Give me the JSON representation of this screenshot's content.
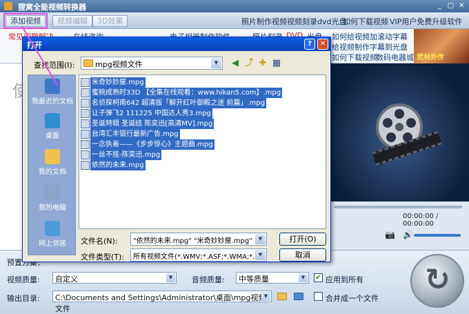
{
  "app": {
    "title": "狸窝全能视频转换器"
  },
  "toolbar": {
    "add_video": "添加视频",
    "video_edit": "视频编辑",
    "effect_3d": "3D效果",
    "links": [
      "照片制作视频",
      "视频刻录dvd光盘",
      "如何下载视频",
      "VIP用户免费升级软件"
    ]
  },
  "banner": {
    "items": [
      "常见问题解决",
      "在线咨询",
      "电子相册制作软件",
      "照片刻录",
      "DVD",
      "光盘",
      "如何给视频加滚动字幕",
      "给视频制作字幕到光盘",
      "如何下载视频",
      "数码电器城"
    ],
    "ad_caption": "武林外传"
  },
  "left_panel": {
    "placeholder_glyph": "使"
  },
  "preview": {
    "time": "00:00:00 / 00:00:00"
  },
  "dialog": {
    "title": "打开",
    "look_in_label": "查找范围(I):",
    "look_in_value": "mpg视频文件",
    "places": [
      "我最近的文档",
      "桌面",
      "我的文档",
      "我的电脑",
      "网上邻居"
    ],
    "files": [
      "米奇妙妙屋.mpg",
      "蜜桃成熟时33D 【全集在线观看：www.hikan5.com】.mpg",
      "名侦探柯南642 超清版「解开红叶御殿之迷 前篇」.mpg",
      "让子弹飞2 111225 中国达人秀3.mpg",
      "圣诞特辑 圣诞结 陈奕迅[高清MV].mpg",
      "台湾汇丰银行最新广告.mpg",
      "一念执着——《步步惊心》主题曲.mpg",
      "一丝不挂-陈奕迅.mpg",
      "依然的未来.mpg"
    ],
    "file_name_label": "文件名(N):",
    "file_name_value": "\"依然的未来.mpg\" \"米奇妙妙屋.mpg\" \"蜜",
    "file_type_label": "文件类型(T):",
    "file_type_value": "所有视频文件(*.WMV;*.ASF;*.WMA;*.AVI;",
    "open_button": "打开(O)",
    "cancel_button": "取消"
  },
  "settings": {
    "preset_label": "预置方案：",
    "video_quality_label": "视频质量:",
    "video_quality_value": "自定义",
    "audio_quality_label": "音频质量:",
    "audio_quality_value": "中等质量",
    "apply_all_label": "应用到所有",
    "output_label": "输出目录:",
    "output_value": "C:\\Documents and Settings\\Administrator\\桌面\\mpg视频文件",
    "merge_label": "合并成一个文件"
  },
  "colors": {
    "highlight": "#e24be0",
    "selection": "#316ac5",
    "dialog_titlebar": "#0a5fdf"
  }
}
